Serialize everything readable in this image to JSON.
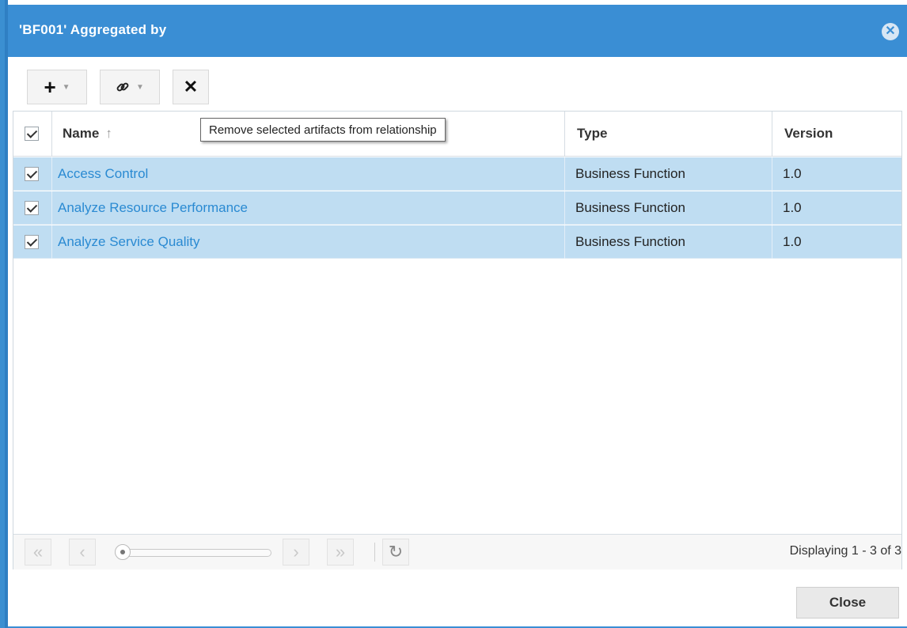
{
  "dialog": {
    "title": "'BF001' Aggregated by",
    "close_icon": "close-circle-icon"
  },
  "toolbar": {
    "add_label": "+",
    "link_icon": "link-icon",
    "remove_label": "✕",
    "tooltip": "Remove selected artifacts from relationship"
  },
  "grid": {
    "columns": [
      {
        "label": "Name",
        "sort": "↑"
      },
      {
        "label": "Type"
      },
      {
        "label": "Version"
      }
    ],
    "rows": [
      {
        "name": "Access Control",
        "type": "Business Function",
        "version": "1.0"
      },
      {
        "name": "Analyze Resource Performance",
        "type": "Business Function",
        "version": "1.0"
      },
      {
        "name": "Analyze Service Quality",
        "type": "Business Function",
        "version": "1.0"
      }
    ]
  },
  "pager": {
    "display": "Displaying 1 - 3 of 3"
  },
  "footer": {
    "close_label": "Close"
  },
  "colors": {
    "title_bar": "#3a8ed4",
    "selected_row": "#bfddf2",
    "link_text": "#2a8ad2"
  }
}
